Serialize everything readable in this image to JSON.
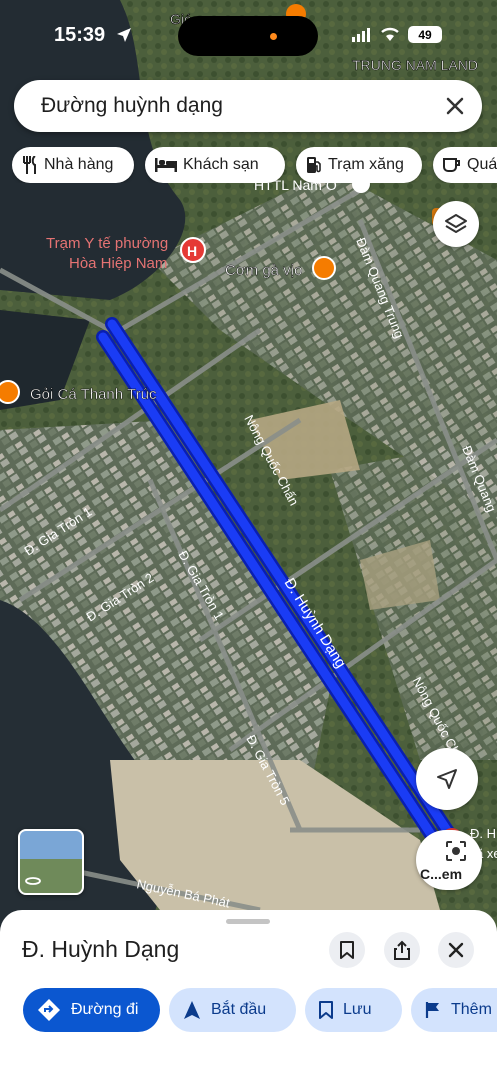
{
  "status": {
    "time": "15:39",
    "battery": "49"
  },
  "search": {
    "query": "Đường huỳnh dạng"
  },
  "chips": [
    "Nhà hàng",
    "Khách sạn",
    "Trạm xăng",
    "Quán"
  ],
  "map": {
    "top_labels": [
      "Gió...",
      "TRUNG NAM LAND"
    ],
    "pois": {
      "clinic": [
        "Trạm Y tế phường",
        "Hòa Hiệp Nam"
      ],
      "htl": "HTTL Nam Ô",
      "com_ga": "Cơm gà vịo",
      "goi_ca": "Gỏi Cá Thanh Trúc"
    },
    "streets": {
      "dam_quang_trung_1": "Đàm Quang Trung",
      "dam_quang_trung_2": "Đàm Quang",
      "nong_quoc_chan_1": "Nông Quốc Chấn",
      "nong_quoc_chan_2": "Nông Quốc Chấn",
      "gia_tron_1a": "Đ. Gia Tròn 1",
      "gia_tron_2": "Đ. Gia Tròn 2",
      "gia_tron_1b": "Đ. Gia Tròn 1",
      "huynh_dang": "Đ. Huỳnh Dạng",
      "gia_tron_5": "Đ. Gia Tròn 5",
      "nguyen_ba_phat": "Nguyễn Bá Phát",
      "edge_h": "Đ. H",
      "edge_xe": "ã xe"
    },
    "colors": {
      "route": "#1a3cf5",
      "route_edge": "#0a1fb0",
      "poi_orange": "#f57c00",
      "hospital_red": "#e53935"
    }
  },
  "lens": {
    "label": "C...em"
  },
  "sheet": {
    "title": "Đ. Huỳnh Dạng",
    "actions": [
      "Đường đi",
      "Bắt đầu",
      "Lưu",
      "Thêm"
    ]
  }
}
